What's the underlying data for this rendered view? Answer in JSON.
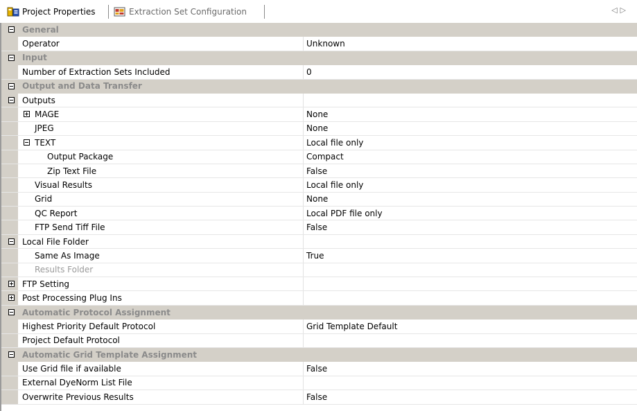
{
  "tabs": [
    {
      "label": "Project Properties",
      "icon": "project-properties-icon",
      "active": true
    },
    {
      "label": "Extraction Set Configuration",
      "icon": "extraction-set-icon",
      "active": false
    }
  ],
  "rows": [
    {
      "type": "category",
      "label": "General",
      "toggle": "minus"
    },
    {
      "type": "prop",
      "level": 0,
      "label": "Operator",
      "value": "Unknown"
    },
    {
      "type": "category",
      "label": "Input",
      "toggle": "minus"
    },
    {
      "type": "prop",
      "level": 0,
      "label": "Number of Extraction Sets Included",
      "value": "0"
    },
    {
      "type": "category",
      "label": "Output and Data Transfer",
      "toggle": "minus"
    },
    {
      "type": "prop",
      "level": 0,
      "label": "Outputs",
      "value": "",
      "toggle": "minus"
    },
    {
      "type": "prop",
      "level": 1,
      "label": "MAGE",
      "value": "None",
      "toggle": "plus"
    },
    {
      "type": "prop",
      "level": 1,
      "label": "JPEG",
      "value": "None"
    },
    {
      "type": "prop",
      "level": 1,
      "label": "TEXT",
      "value": "Local file only",
      "toggle": "minus"
    },
    {
      "type": "prop",
      "level": 2,
      "label": "Output Package",
      "value": "Compact"
    },
    {
      "type": "prop",
      "level": 2,
      "label": "Zip Text File",
      "value": "False"
    },
    {
      "type": "prop",
      "level": 1,
      "label": "Visual Results",
      "value": "Local file only"
    },
    {
      "type": "prop",
      "level": 1,
      "label": "Grid",
      "value": "None"
    },
    {
      "type": "prop",
      "level": 1,
      "label": "QC Report",
      "value": "Local PDF file only"
    },
    {
      "type": "prop",
      "level": 1,
      "label": "FTP Send Tiff File",
      "value": "False"
    },
    {
      "type": "prop",
      "level": 0,
      "label": "Local File Folder",
      "value": "",
      "toggle": "minus"
    },
    {
      "type": "prop",
      "level": 1,
      "label": "Same As Image",
      "value": "True"
    },
    {
      "type": "prop",
      "level": 1,
      "label": "Results Folder",
      "value": "",
      "disabled": true
    },
    {
      "type": "prop",
      "level": 0,
      "label": "FTP Setting",
      "value": "",
      "toggle": "plus"
    },
    {
      "type": "prop",
      "level": 0,
      "label": "Post Processing Plug Ins",
      "value": "",
      "toggle": "plus"
    },
    {
      "type": "category",
      "label": "Automatic Protocol Assignment",
      "toggle": "minus"
    },
    {
      "type": "prop",
      "level": 0,
      "label": "Highest Priority Default Protocol",
      "value": "Grid Template Default"
    },
    {
      "type": "prop",
      "level": 0,
      "label": "Project Default Protocol",
      "value": ""
    },
    {
      "type": "category",
      "label": "Automatic Grid Template Assignment",
      "toggle": "minus"
    },
    {
      "type": "prop",
      "level": 0,
      "label": "Use Grid file if available",
      "value": "False"
    },
    {
      "type": "prop",
      "level": 0,
      "label": "External DyeNorm List File",
      "value": ""
    },
    {
      "type": "prop",
      "level": 0,
      "label": "Overwrite Previous Results",
      "value": "False"
    }
  ],
  "colors": {
    "gutter": "#d4d0c8",
    "category_text": "#8b8b8b",
    "disabled_text": "#9a9a9a"
  }
}
